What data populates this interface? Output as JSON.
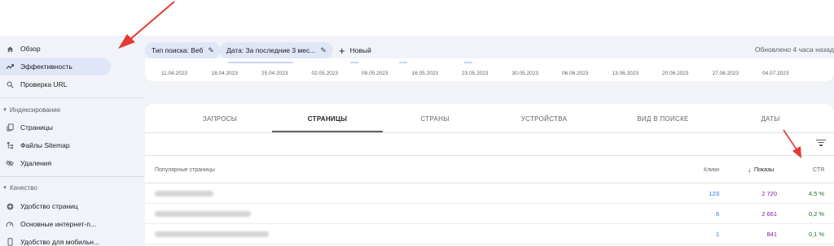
{
  "sidebar": {
    "items": [
      {
        "label": "Обзор",
        "icon": "home-icon"
      },
      {
        "label": "Эффективность",
        "icon": "trending-up-icon",
        "active": true
      },
      {
        "label": "Проверка URL",
        "icon": "search-icon"
      }
    ],
    "sections": [
      {
        "title": "Индексирование",
        "items": [
          {
            "label": "Страницы",
            "icon": "pages-icon"
          },
          {
            "label": "Файлы Sitemap",
            "icon": "sitemap-icon"
          },
          {
            "label": "Удаления",
            "icon": "visibility-off-icon"
          }
        ]
      },
      {
        "title": "Качество",
        "items": [
          {
            "label": "Удобство страниц",
            "icon": "plus-circle-icon"
          },
          {
            "label": "Основные интернет-п...",
            "icon": "speed-gauge-icon"
          },
          {
            "label": "Удобство для мобильн...",
            "icon": "smartphone-icon"
          }
        ]
      }
    ]
  },
  "filters": {
    "search_type": "Тип поиска: Веб",
    "date": "Дата: За последние 3 мес...",
    "new_label": "Новый",
    "updated": "Обновлено 4 часа назад"
  },
  "dates": [
    "11.04.2023",
    "18.04.2023",
    "25.04.2023",
    "02.05.2023",
    "09.05.2023",
    "16.05.2023",
    "23.05.2023",
    "30.05.2023",
    "06.06.2023",
    "13.06.2023",
    "20.06.2023",
    "27.06.2023",
    "04.07.2023"
  ],
  "tabs": [
    "ЗАПРОСЫ",
    "СТРАНИЦЫ",
    "СТРАНЫ",
    "УСТРОЙСТВА",
    "ВИД В ПОИСКЕ",
    "ДАТЫ"
  ],
  "active_tab": "СТРАНИЦЫ",
  "table": {
    "headers": {
      "page": "Популярные страницы",
      "clicks": "Клики",
      "shows": "Показы",
      "ctr": "CTR"
    },
    "sorted_by": "Показы",
    "rows": [
      {
        "clicks": "123",
        "shows": "2 720",
        "ctr": "4,5 %"
      },
      {
        "clicks": "6",
        "shows": "2 661",
        "ctr": "0,2 %"
      },
      {
        "clicks": "1",
        "shows": "841",
        "ctr": "0,1 %"
      }
    ]
  },
  "colors": {
    "accent": "#1a73e8",
    "shows": "#7b1fa2",
    "ctr": "#137333",
    "annotation": "#e53935"
  }
}
